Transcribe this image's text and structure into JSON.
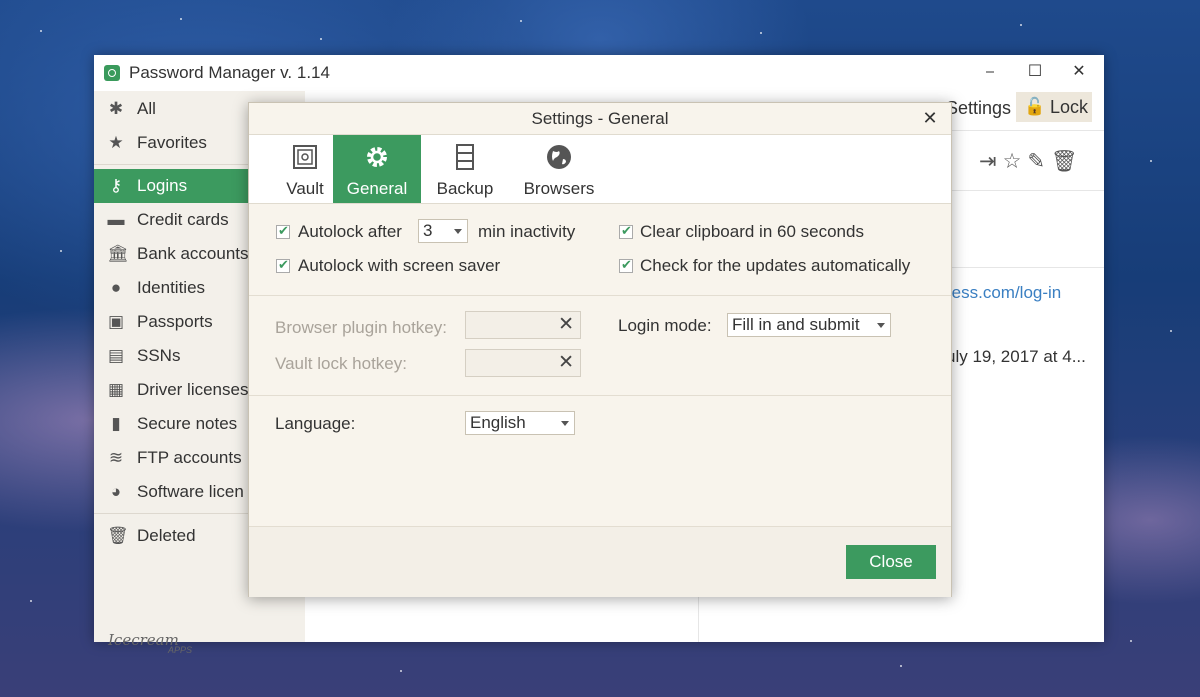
{
  "app": {
    "title": "Password Manager v. 1.14",
    "brand": "Icecream",
    "brand_sub": "APPS"
  },
  "window_controls": {
    "minimize": "⎯",
    "maximize": "☐",
    "close": "✕"
  },
  "sidebar": {
    "items": [
      {
        "label": "All",
        "icon": "asterisk-icon"
      },
      {
        "label": "Favorites",
        "icon": "star-icon"
      },
      {
        "label": "Logins",
        "icon": "key-icon",
        "active": true
      },
      {
        "label": "Credit cards",
        "icon": "credit-card-icon"
      },
      {
        "label": "Bank accounts",
        "icon": "bank-icon"
      },
      {
        "label": "Identities",
        "icon": "person-icon"
      },
      {
        "label": "Passports",
        "icon": "passport-icon"
      },
      {
        "label": "SSNs",
        "icon": "ssn-icon"
      },
      {
        "label": "Driver licenses",
        "icon": "id-card-icon"
      },
      {
        "label": "Secure notes",
        "icon": "note-icon"
      },
      {
        "label": "FTP accounts",
        "icon": "database-icon"
      },
      {
        "label": "Software licen",
        "icon": "disc-icon"
      },
      {
        "label": "Deleted",
        "icon": "trash-icon"
      }
    ]
  },
  "header": {
    "settings_label": "Settings",
    "lock_label": "Lock"
  },
  "background": {
    "link_text": "ress.com/log-in",
    "date_text": "uly 19, 2017 at 4..."
  },
  "dialog": {
    "title": "Settings - General",
    "tabs": [
      {
        "label": "Vault",
        "icon": "vault-icon"
      },
      {
        "label": "General",
        "icon": "gear-icon",
        "active": true
      },
      {
        "label": "Backup",
        "icon": "cabinet-icon"
      },
      {
        "label": "Browsers",
        "icon": "globe-icon"
      }
    ],
    "autolock_label": "Autolock after",
    "autolock_value": "3",
    "autolock_suffix": "min inactivity",
    "screensaver_label": "Autolock with screen saver",
    "clipboard_label": "Clear clipboard in 60 seconds",
    "updates_label": "Check for the updates automatically",
    "plugin_hotkey_label": "Browser plugin hotkey:",
    "vault_hotkey_label": "Vault lock hotkey:",
    "login_mode_label": "Login mode:",
    "login_mode_value": "Fill in and submit",
    "language_label": "Language:",
    "language_value": "English",
    "close_label": "Close"
  },
  "colors": {
    "accent": "#3c9a5f",
    "dialog_bg": "#f8f4ec",
    "sidebar_bg": "#f3f0ea"
  }
}
